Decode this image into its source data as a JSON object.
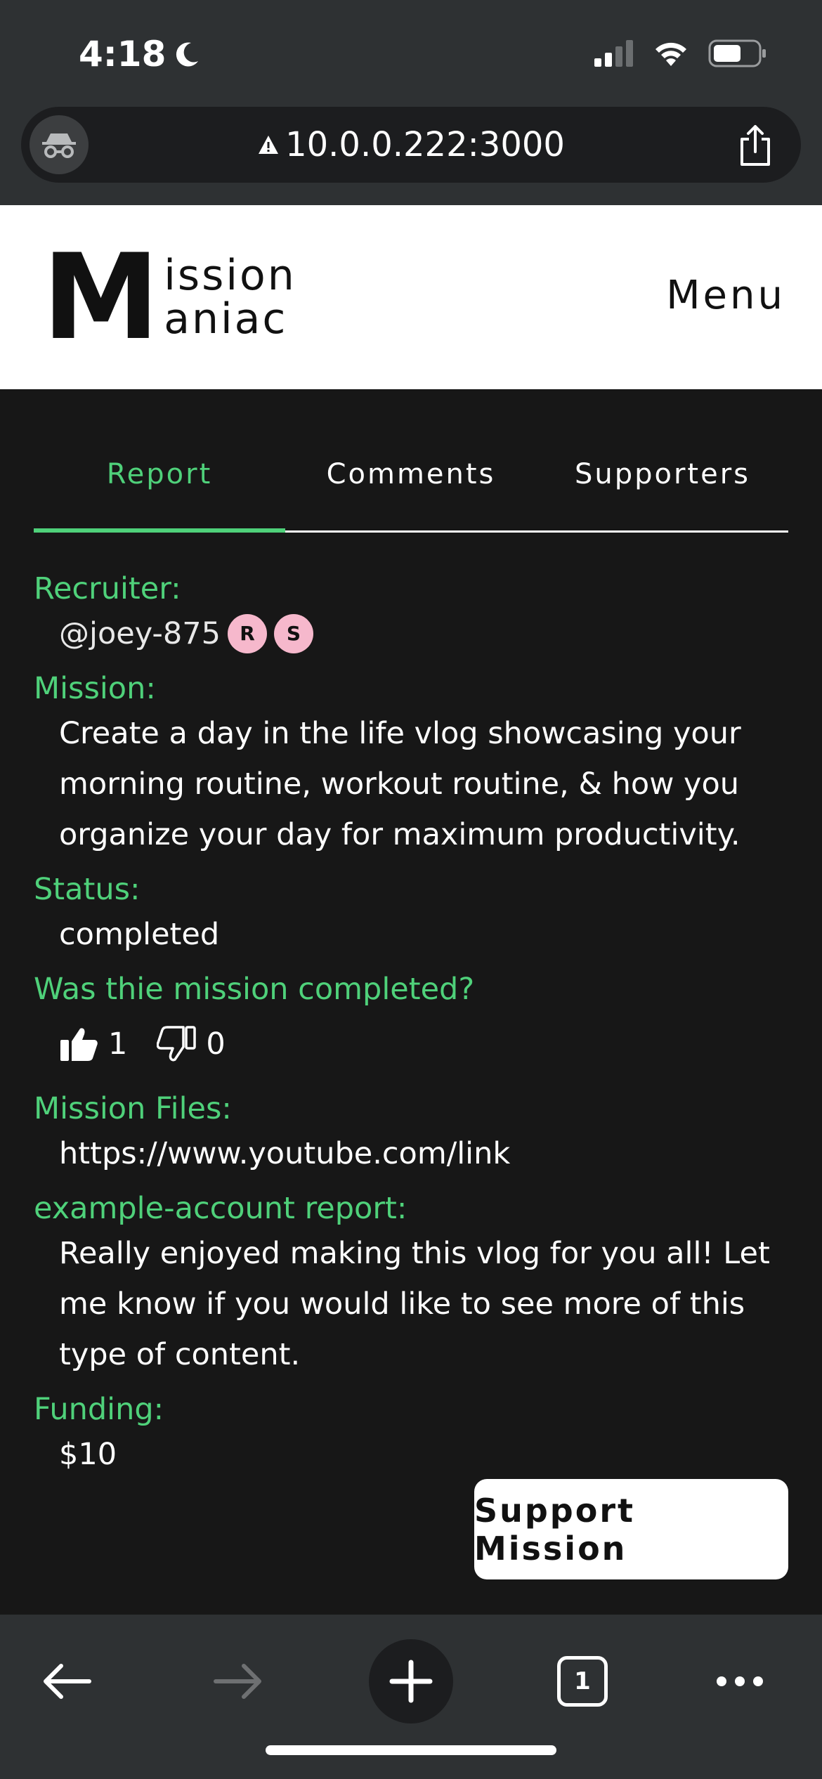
{
  "status_bar": {
    "time": "4:18",
    "moon_icon": "moon-icon",
    "signal_icon": "signal-icon",
    "wifi_icon": "wifi-icon",
    "battery_icon": "battery-icon"
  },
  "browser": {
    "url": "10.0.0.222:3000",
    "private_icon": "incognito-icon",
    "warning_icon": "warning-icon",
    "share_icon": "share-icon",
    "tab_count": "1"
  },
  "header": {
    "logo_initial": "M",
    "logo_word_1": "ission",
    "logo_word_2": "aniac",
    "menu_label": "Menu"
  },
  "tabs": [
    {
      "label": "Report",
      "active": true
    },
    {
      "label": "Comments",
      "active": false
    },
    {
      "label": "Supporters",
      "active": false
    }
  ],
  "report": {
    "recruiter_label": "Recruiter:",
    "recruiter_handle": "@joey-875",
    "badges": [
      "R",
      "S"
    ],
    "mission_label": "Mission:",
    "mission_text": "Create a day in the life vlog showcasing your morning routine, workout routine, & how you organize your day for maximum productivity.",
    "status_label": "Status:",
    "status_value": "completed",
    "completed_label": "Was thie mission completed?",
    "thumbs_up_count": "1",
    "thumbs_down_count": "0",
    "files_label": "Mission Files:",
    "files_value": "https://www.youtube.com/link",
    "account_report_label": "example-account report:",
    "account_report_text": "Really enjoyed making this vlog for you all! Let me know if you would like to see more of this type of content.",
    "funding_label": "Funding:",
    "funding_value": "$10"
  },
  "cta": {
    "support_label": "Support Mission"
  },
  "colors": {
    "accent": "#4fd17a",
    "background": "#171717",
    "chrome": "#2e3133",
    "badge": "#f6b8cc"
  }
}
